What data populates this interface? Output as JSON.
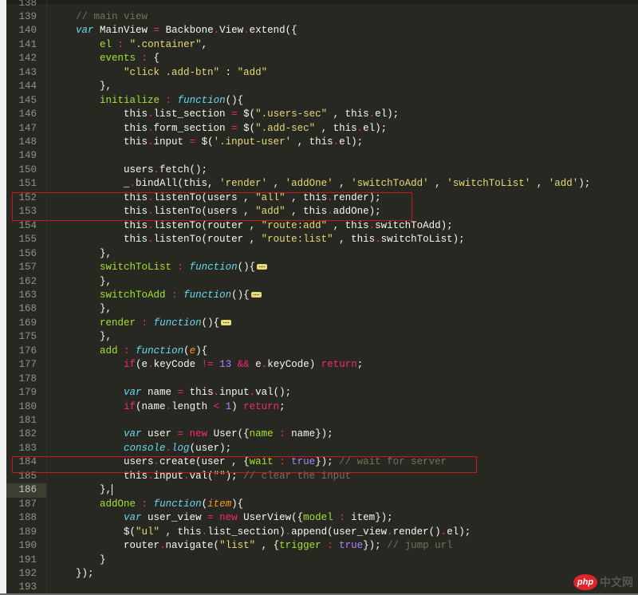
{
  "editor": {
    "theme_colors": {
      "background": "#272822",
      "keyword": "#f92672",
      "string": "#e6db74",
      "comment": "#75715e",
      "function": "#66d9ef",
      "property": "#a6e22e",
      "number": "#ae81ff",
      "parameter": "#fd971f",
      "highlight_box": "#d0141a"
    },
    "current_line": "186",
    "highlighted_lines": [
      [
        "152",
        "153"
      ],
      [
        "184"
      ]
    ],
    "lines": [
      {
        "n": "138",
        "tokens": []
      },
      {
        "n": "139",
        "tokens": [
          [
            "t",
            "    "
          ],
          [
            "c",
            "// main view"
          ]
        ]
      },
      {
        "n": "140",
        "tokens": [
          [
            "t",
            "    "
          ],
          [
            "v",
            "var"
          ],
          [
            "t",
            " MainView "
          ],
          [
            "k",
            "="
          ],
          [
            "t",
            " Backbone"
          ],
          [
            "k",
            "."
          ],
          [
            "t",
            "View"
          ],
          [
            "k",
            "."
          ],
          [
            "t",
            "extend({"
          ]
        ]
      },
      {
        "n": "141",
        "tokens": [
          [
            "t",
            "        "
          ],
          [
            "p",
            "el"
          ],
          [
            "k",
            " :"
          ],
          [
            "t",
            " "
          ],
          [
            "s",
            "\".container\""
          ],
          [
            "t",
            ","
          ]
        ]
      },
      {
        "n": "142",
        "tokens": [
          [
            "t",
            "        "
          ],
          [
            "p",
            "events"
          ],
          [
            "k",
            " :"
          ],
          [
            "t",
            " {"
          ]
        ]
      },
      {
        "n": "143",
        "tokens": [
          [
            "t",
            "            "
          ],
          [
            "s",
            "\"click .add-btn\""
          ],
          [
            "t",
            " : "
          ],
          [
            "s",
            "\"add\""
          ]
        ]
      },
      {
        "n": "144",
        "tokens": [
          [
            "t",
            "        },"
          ]
        ]
      },
      {
        "n": "145",
        "tokens": [
          [
            "t",
            "        "
          ],
          [
            "p",
            "initialize"
          ],
          [
            "k",
            " :"
          ],
          [
            "t",
            " "
          ],
          [
            "f",
            "function"
          ],
          [
            "t",
            "(){"
          ]
        ]
      },
      {
        "n": "146",
        "tokens": [
          [
            "t",
            "            this"
          ],
          [
            "k",
            "."
          ],
          [
            "t",
            "list_section "
          ],
          [
            "k",
            "="
          ],
          [
            "t",
            " $("
          ],
          [
            "s",
            "\".users-sec\""
          ],
          [
            "t",
            " , this"
          ],
          [
            "k",
            "."
          ],
          [
            "t",
            "el);"
          ]
        ]
      },
      {
        "n": "147",
        "tokens": [
          [
            "t",
            "            this"
          ],
          [
            "k",
            "."
          ],
          [
            "t",
            "form_section "
          ],
          [
            "k",
            "="
          ],
          [
            "t",
            " $("
          ],
          [
            "s",
            "\".add-sec\""
          ],
          [
            "t",
            " , this"
          ],
          [
            "k",
            "."
          ],
          [
            "t",
            "el);"
          ]
        ]
      },
      {
        "n": "148",
        "tokens": [
          [
            "t",
            "            this"
          ],
          [
            "k",
            "."
          ],
          [
            "t",
            "input "
          ],
          [
            "k",
            "="
          ],
          [
            "t",
            " $("
          ],
          [
            "s",
            "'.input-user'"
          ],
          [
            "t",
            " , this"
          ],
          [
            "k",
            "."
          ],
          [
            "t",
            "el);"
          ]
        ]
      },
      {
        "n": "149",
        "tokens": []
      },
      {
        "n": "150",
        "tokens": [
          [
            "t",
            "            users"
          ],
          [
            "k",
            "."
          ],
          [
            "t",
            "fetch();"
          ]
        ]
      },
      {
        "n": "151",
        "tokens": [
          [
            "t",
            "            _"
          ],
          [
            "k",
            "."
          ],
          [
            "t",
            "bindAll(this, "
          ],
          [
            "s",
            "'render'"
          ],
          [
            "t",
            " , "
          ],
          [
            "s",
            "'addOne'"
          ],
          [
            "t",
            " , "
          ],
          [
            "s",
            "'switchToAdd'"
          ],
          [
            "t",
            " , "
          ],
          [
            "s",
            "'switchToList'"
          ],
          [
            "t",
            " , "
          ],
          [
            "s",
            "'add'"
          ],
          [
            "t",
            ");"
          ]
        ]
      },
      {
        "n": "152",
        "tokens": [
          [
            "t",
            "            this"
          ],
          [
            "k",
            "."
          ],
          [
            "t",
            "listenTo(users , "
          ],
          [
            "s",
            "\"all\""
          ],
          [
            "t",
            " , this"
          ],
          [
            "k",
            "."
          ],
          [
            "t",
            "render);"
          ]
        ]
      },
      {
        "n": "153",
        "tokens": [
          [
            "t",
            "            this"
          ],
          [
            "k",
            "."
          ],
          [
            "t",
            "listenTo(users , "
          ],
          [
            "s",
            "\"add\""
          ],
          [
            "t",
            " , this"
          ],
          [
            "k",
            "."
          ],
          [
            "t",
            "addOne);"
          ]
        ]
      },
      {
        "n": "154",
        "tokens": [
          [
            "t",
            "            this"
          ],
          [
            "k",
            "."
          ],
          [
            "t",
            "listenTo(router , "
          ],
          [
            "s",
            "\"route:add\""
          ],
          [
            "t",
            " , this"
          ],
          [
            "k",
            "."
          ],
          [
            "t",
            "switchToAdd);"
          ]
        ]
      },
      {
        "n": "155",
        "tokens": [
          [
            "t",
            "            this"
          ],
          [
            "k",
            "."
          ],
          [
            "t",
            "listenTo(router , "
          ],
          [
            "s",
            "\"route:list\""
          ],
          [
            "t",
            " , this"
          ],
          [
            "k",
            "."
          ],
          [
            "t",
            "switchToList);"
          ]
        ]
      },
      {
        "n": "156",
        "tokens": [
          [
            "t",
            "        },"
          ]
        ]
      },
      {
        "n": "157",
        "fold": true,
        "tokens": [
          [
            "t",
            "        "
          ],
          [
            "p",
            "switchToList"
          ],
          [
            "k",
            " :"
          ],
          [
            "t",
            " "
          ],
          [
            "f",
            "function"
          ],
          [
            "t",
            "(){"
          ]
        ]
      },
      {
        "n": "162",
        "tokens": [
          [
            "t",
            "        },"
          ]
        ]
      },
      {
        "n": "163",
        "fold": true,
        "tokens": [
          [
            "t",
            "        "
          ],
          [
            "p",
            "switchToAdd"
          ],
          [
            "k",
            " :"
          ],
          [
            "t",
            " "
          ],
          [
            "f",
            "function"
          ],
          [
            "t",
            "(){"
          ]
        ]
      },
      {
        "n": "168",
        "tokens": [
          [
            "t",
            "        },"
          ]
        ]
      },
      {
        "n": "169",
        "fold": true,
        "tokens": [
          [
            "t",
            "        "
          ],
          [
            "p",
            "render"
          ],
          [
            "k",
            " :"
          ],
          [
            "t",
            " "
          ],
          [
            "f",
            "function"
          ],
          [
            "t",
            "(){"
          ]
        ]
      },
      {
        "n": "175",
        "tokens": [
          [
            "t",
            "        },"
          ]
        ]
      },
      {
        "n": "176",
        "tokens": [
          [
            "t",
            "        "
          ],
          [
            "p",
            "add"
          ],
          [
            "k",
            " :"
          ],
          [
            "t",
            " "
          ],
          [
            "f",
            "function"
          ],
          [
            "t",
            "("
          ],
          [
            "o",
            "e"
          ],
          [
            "t",
            "){"
          ]
        ]
      },
      {
        "n": "177",
        "tokens": [
          [
            "t",
            "            "
          ],
          [
            "k",
            "if"
          ],
          [
            "t",
            "(e"
          ],
          [
            "k",
            "."
          ],
          [
            "t",
            "keyCode "
          ],
          [
            "k",
            "!="
          ],
          [
            "t",
            " "
          ],
          [
            "n",
            "13"
          ],
          [
            "t",
            " "
          ],
          [
            "k",
            "&&"
          ],
          [
            "t",
            " e"
          ],
          [
            "k",
            "."
          ],
          [
            "t",
            "keyCode) "
          ],
          [
            "k",
            "return"
          ],
          [
            "t",
            ";"
          ]
        ]
      },
      {
        "n": "178",
        "tokens": []
      },
      {
        "n": "179",
        "tokens": [
          [
            "t",
            "            "
          ],
          [
            "v",
            "var"
          ],
          [
            "t",
            " name "
          ],
          [
            "k",
            "="
          ],
          [
            "t",
            " this"
          ],
          [
            "k",
            "."
          ],
          [
            "t",
            "input"
          ],
          [
            "k",
            "."
          ],
          [
            "t",
            "val();"
          ]
        ]
      },
      {
        "n": "180",
        "tokens": [
          [
            "t",
            "            "
          ],
          [
            "k",
            "if"
          ],
          [
            "t",
            "(name"
          ],
          [
            "k",
            "."
          ],
          [
            "t",
            "length "
          ],
          [
            "k",
            "<"
          ],
          [
            "t",
            " "
          ],
          [
            "n",
            "1"
          ],
          [
            "t",
            ") "
          ],
          [
            "k",
            "return"
          ],
          [
            "t",
            ";"
          ]
        ]
      },
      {
        "n": "181",
        "tokens": []
      },
      {
        "n": "182",
        "tokens": [
          [
            "t",
            "            "
          ],
          [
            "v",
            "var"
          ],
          [
            "t",
            " user "
          ],
          [
            "k",
            "="
          ],
          [
            "t",
            " "
          ],
          [
            "k",
            "new"
          ],
          [
            "t",
            " User({"
          ],
          [
            "p",
            "name"
          ],
          [
            "k",
            " :"
          ],
          [
            "t",
            " name});"
          ]
        ]
      },
      {
        "n": "183",
        "tokens": [
          [
            "t",
            "            "
          ],
          [
            "f",
            "console"
          ],
          [
            "k",
            "."
          ],
          [
            "f",
            "log"
          ],
          [
            "t",
            "(user);"
          ]
        ]
      },
      {
        "n": "184",
        "tokens": [
          [
            "t",
            "            users"
          ],
          [
            "k",
            "."
          ],
          [
            "t",
            "create(user , {"
          ],
          [
            "p",
            "wait"
          ],
          [
            "k",
            " :"
          ],
          [
            "t",
            " "
          ],
          [
            "n",
            "true"
          ],
          [
            "t",
            "}); "
          ],
          [
            "c",
            "// wait for server"
          ]
        ]
      },
      {
        "n": "185",
        "tokens": [
          [
            "t",
            "            this"
          ],
          [
            "k",
            "."
          ],
          [
            "t",
            "input"
          ],
          [
            "k",
            "."
          ],
          [
            "t",
            "val("
          ],
          [
            "s",
            "\"\""
          ],
          [
            "t",
            "); "
          ],
          [
            "c",
            "// clear the input"
          ]
        ]
      },
      {
        "n": "186",
        "caret": true,
        "tokens": [
          [
            "t",
            "        },"
          ]
        ]
      },
      {
        "n": "187",
        "tokens": [
          [
            "t",
            "        "
          ],
          [
            "p",
            "addOne"
          ],
          [
            "k",
            " :"
          ],
          [
            "t",
            " "
          ],
          [
            "f",
            "function"
          ],
          [
            "t",
            "("
          ],
          [
            "o",
            "item"
          ],
          [
            "t",
            "){"
          ]
        ]
      },
      {
        "n": "188",
        "tokens": [
          [
            "t",
            "            "
          ],
          [
            "v",
            "var"
          ],
          [
            "t",
            " user_view "
          ],
          [
            "k",
            "="
          ],
          [
            "t",
            " "
          ],
          [
            "k",
            "new"
          ],
          [
            "t",
            " UserView({"
          ],
          [
            "p",
            "model"
          ],
          [
            "k",
            " :"
          ],
          [
            "t",
            " item});"
          ]
        ]
      },
      {
        "n": "189",
        "tokens": [
          [
            "t",
            "            $("
          ],
          [
            "s",
            "\"ul\""
          ],
          [
            "t",
            " , this"
          ],
          [
            "k",
            "."
          ],
          [
            "t",
            "list_section)"
          ],
          [
            "k",
            "."
          ],
          [
            "t",
            "append(user_view"
          ],
          [
            "k",
            "."
          ],
          [
            "t",
            "render()"
          ],
          [
            "k",
            "."
          ],
          [
            "t",
            "el);"
          ]
        ]
      },
      {
        "n": "190",
        "tokens": [
          [
            "t",
            "            router"
          ],
          [
            "k",
            "."
          ],
          [
            "t",
            "navigate("
          ],
          [
            "s",
            "\"list\""
          ],
          [
            "t",
            " , {"
          ],
          [
            "p",
            "trigger"
          ],
          [
            "k",
            " :"
          ],
          [
            "t",
            " "
          ],
          [
            "n",
            "true"
          ],
          [
            "t",
            "}); "
          ],
          [
            "c",
            "// jump url"
          ]
        ]
      },
      {
        "n": "191",
        "tokens": [
          [
            "t",
            "        }"
          ]
        ]
      },
      {
        "n": "192",
        "tokens": [
          [
            "t",
            "    });"
          ]
        ]
      },
      {
        "n": "193",
        "tokens": []
      }
    ]
  },
  "watermark": {
    "logo": "php",
    "text": "中文网"
  }
}
